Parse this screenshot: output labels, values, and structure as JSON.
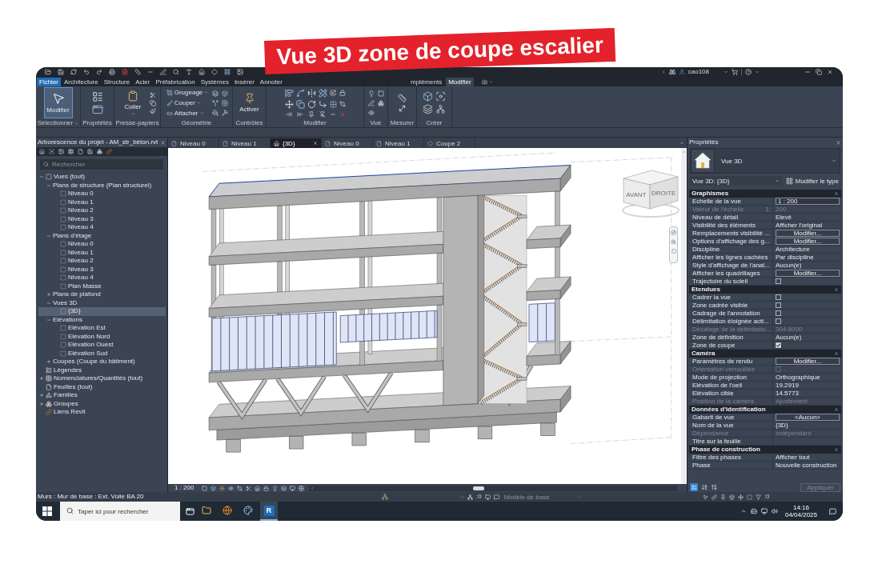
{
  "headline": {
    "text": "Vue 3D zone de coupe escalier"
  },
  "title_bar": {
    "user": "cao108"
  },
  "ribbon": {
    "tabs": [
      {
        "label": "Fichier",
        "kind": "file",
        "selected": false
      },
      {
        "label": "Architecture",
        "kind": "tab",
        "selected": false
      },
      {
        "label": "Structure",
        "kind": "tab",
        "selected": false
      },
      {
        "label": "Acier",
        "kind": "tab",
        "selected": false
      },
      {
        "label": "Préfabrication",
        "kind": "tab",
        "selected": false
      },
      {
        "label": "Systèmes",
        "kind": "tab",
        "selected": false
      },
      {
        "label": "Insérer",
        "kind": "tab",
        "selected": false
      },
      {
        "label": "Annoter",
        "kind": "tab",
        "selected": false
      },
      {
        "label": "mpléments",
        "kind": "tab",
        "selected": false
      },
      {
        "label": "Modifier",
        "kind": "tab",
        "selected": true
      }
    ],
    "groups": [
      {
        "kind": "select",
        "label": "Sélectionner",
        "dropdown": true,
        "tools": [
          {
            "label": "Modifier",
            "selected": true,
            "dropdown": false
          }
        ]
      },
      {
        "kind": "properties",
        "label": "Propriétés",
        "dropdown": false
      },
      {
        "kind": "clipboard",
        "label": "Presse-papiers",
        "dropdown": false,
        "tools": [
          {
            "label": "Coller",
            "selected": false,
            "dropdown": true
          }
        ]
      },
      {
        "kind": "geometry",
        "label": "Géométrie",
        "dropdown": false,
        "tools": [
          {
            "label": "Grugeage",
            "selected": false,
            "dropdown": true
          },
          {
            "label": "Couper",
            "selected": false,
            "dropdown": true
          },
          {
            "label": "Attacher",
            "selected": false,
            "dropdown": true
          }
        ]
      },
      {
        "kind": "controls",
        "label": "Contrôles",
        "dropdown": false,
        "tools": [
          {
            "label": "Activer",
            "selected": false,
            "dropdown": false
          }
        ]
      },
      {
        "kind": "modify",
        "label": "Modifier",
        "dropdown": false
      },
      {
        "kind": "view",
        "label": "Vue",
        "dropdown": false
      },
      {
        "kind": "measure",
        "label": "Mesurer",
        "dropdown": false
      },
      {
        "kind": "create",
        "label": "Créer",
        "dropdown": false
      }
    ]
  },
  "project_browser": {
    "title": "Arborescence du projet - AM_str_béton.rvt",
    "search": {
      "placeholder": "Rechercher"
    },
    "tree": [
      {
        "label": "Vues (tout)",
        "kind": "views",
        "expanded": true,
        "selected": false,
        "children": [
          {
            "label": "Plans de structure (Plan structurel)",
            "kind": "category",
            "expanded": true,
            "selected": false,
            "children": [
              {
                "label": "Niveau 0",
                "kind": "view",
                "selected": false
              },
              {
                "label": "Niveau 1",
                "kind": "view",
                "selected": false
              },
              {
                "label": "Niveau 2",
                "kind": "view",
                "selected": false
              },
              {
                "label": "Niveau 3",
                "kind": "view",
                "selected": false
              },
              {
                "label": "Niveau 4",
                "kind": "view",
                "selected": false
              }
            ]
          },
          {
            "label": "Plans d'étage",
            "kind": "category",
            "expanded": true,
            "selected": false,
            "children": [
              {
                "label": "Niveau 0",
                "kind": "view",
                "selected": false
              },
              {
                "label": "Niveau 1",
                "kind": "view",
                "selected": false
              },
              {
                "label": "Niveau 2",
                "kind": "view",
                "selected": false
              },
              {
                "label": "Niveau 3",
                "kind": "view",
                "selected": false
              },
              {
                "label": "Niveau 4",
                "kind": "view",
                "selected": false
              },
              {
                "label": "Plan Masse",
                "kind": "view",
                "selected": false
              }
            ]
          },
          {
            "label": "Plans de plafond",
            "kind": "category",
            "expanded": false,
            "selected": false
          },
          {
            "label": "Vues 3D",
            "kind": "category",
            "expanded": true,
            "selected": false,
            "children": [
              {
                "label": "{3D}",
                "kind": "view",
                "selected": true
              }
            ]
          },
          {
            "label": "Elévations",
            "kind": "category",
            "expanded": true,
            "selected": false,
            "children": [
              {
                "label": "Elévation Est",
                "kind": "view",
                "selected": false
              },
              {
                "label": "Elévation Nord",
                "kind": "view",
                "selected": false
              },
              {
                "label": "Elévation Ouest",
                "kind": "view",
                "selected": false
              },
              {
                "label": "Elévation Sud",
                "kind": "view",
                "selected": false
              }
            ]
          },
          {
            "label": "Coupes (Coupe du bâtiment)",
            "kind": "category",
            "expanded": false,
            "selected": false
          }
        ]
      },
      {
        "label": "Légendes",
        "kind": "legends",
        "selected": false
      },
      {
        "label": "Nomenclatures/Quantités (tout)",
        "kind": "schedules",
        "expanded": false,
        "selected": false
      },
      {
        "label": "Feuilles (tout)",
        "kind": "sheets",
        "selected": false
      },
      {
        "label": "Familles",
        "kind": "families",
        "expanded": false,
        "selected": false
      },
      {
        "label": "Groupes",
        "kind": "groups",
        "expanded": false,
        "selected": false
      },
      {
        "label": "Liens Revit",
        "kind": "links",
        "selected": false
      }
    ]
  },
  "view_tabs": [
    {
      "label": "Niveau 0",
      "kind": "plan",
      "selected": false
    },
    {
      "label": "Niveau 1",
      "kind": "plan",
      "selected": false
    },
    {
      "label": "{3D}",
      "kind": "model",
      "selected": true
    },
    {
      "label": "Niveau 0",
      "kind": "plan",
      "selected": false
    },
    {
      "label": "Niveau 1",
      "kind": "plan",
      "selected": false
    },
    {
      "label": "Coupe 2",
      "kind": "section",
      "selected": false
    }
  ],
  "viewport": {
    "view_cube": {
      "front": "AVANT",
      "right": "DROITE"
    }
  },
  "view_control_bar": {
    "scale": "1 : 200"
  },
  "properties": {
    "title": "Propriétés",
    "type": "Vue 3D",
    "instance": "Vue 3D: {3D}",
    "edit_type": "Modifier le type",
    "sections": [
      {
        "title": "Graphismes",
        "expanded": true,
        "rows": [
          {
            "kind": "input",
            "label": "Echelle de la vue",
            "value": "1 : 200",
            "disabled": false
          },
          {
            "kind": "text",
            "label": "Valeur de l'échelle",
            "unit": "1:",
            "value": "200",
            "disabled": true
          },
          {
            "kind": "text",
            "label": "Niveau de détail",
            "value": "Elevé",
            "disabled": false
          },
          {
            "kind": "text",
            "label": "Visibilité des éléments",
            "value": "Afficher l'original",
            "disabled": false
          },
          {
            "kind": "button",
            "label": "Remplacements visibilité ...",
            "value": "Modifier...",
            "disabled": false
          },
          {
            "kind": "button",
            "label": "Options d'affichage des g...",
            "value": "Modifier...",
            "disabled": false
          },
          {
            "kind": "text",
            "label": "Discipline",
            "value": "Architecture",
            "disabled": false
          },
          {
            "kind": "text",
            "label": "Afficher les lignes cachées",
            "value": "Par discipline",
            "disabled": false
          },
          {
            "kind": "text",
            "label": "Style d'affichage de l'anal...",
            "value": "Aucun(e)",
            "disabled": false
          },
          {
            "kind": "button",
            "label": "Afficher les quadrillages",
            "value": "Modifier...",
            "disabled": false
          },
          {
            "kind": "checkbox",
            "label": "Trajectoire du soleil",
            "checked": false,
            "disabled": false
          }
        ]
      },
      {
        "title": "Etendues",
        "expanded": true,
        "rows": [
          {
            "kind": "checkbox",
            "label": "Cadrer la vue",
            "checked": false,
            "disabled": false
          },
          {
            "kind": "checkbox",
            "label": "Zone cadrée visible",
            "checked": false,
            "disabled": false
          },
          {
            "kind": "checkbox",
            "label": "Cadrage de l'annotation",
            "checked": false,
            "disabled": false
          },
          {
            "kind": "checkbox",
            "label": "Délimitation éloignée acti...",
            "checked": false,
            "disabled": false
          },
          {
            "kind": "text",
            "label": "Décalage de la délimitatio...",
            "value": "304.8000",
            "disabled": true
          },
          {
            "kind": "text",
            "label": "Zone de définition",
            "value": "Aucun(e)",
            "disabled": false
          },
          {
            "kind": "checkbox",
            "label": "Zone de coupe",
            "checked": true,
            "disabled": false
          }
        ]
      },
      {
        "title": "Caméra",
        "expanded": true,
        "rows": [
          {
            "kind": "button",
            "label": "Paramètres de rendu",
            "value": "Modifier...",
            "disabled": false
          },
          {
            "kind": "checkbox",
            "label": "Orientation verrouillée",
            "checked": false,
            "disabled": true
          },
          {
            "kind": "text",
            "label": "Mode de projection",
            "value": "Orthographique",
            "disabled": false
          },
          {
            "kind": "text",
            "label": "Elévation de l'oeil",
            "value": "19.2919",
            "disabled": false
          },
          {
            "kind": "text",
            "label": "Elévation cible",
            "value": "14.5773",
            "disabled": false
          },
          {
            "kind": "text",
            "label": "Position de la caméra",
            "value": "Ajustement",
            "disabled": true
          }
        ]
      },
      {
        "title": "Données d'identification",
        "expanded": true,
        "rows": [
          {
            "kind": "button",
            "label": "Gabarit de vue",
            "value": "<Aucun>",
            "disabled": false
          },
          {
            "kind": "text",
            "label": "Nom de la vue",
            "value": "{3D}",
            "disabled": false
          },
          {
            "kind": "text",
            "label": "Dépendance",
            "value": "Indépendant",
            "disabled": true
          },
          {
            "kind": "text",
            "label": "Titre sur la feuille",
            "disabled": false
          }
        ]
      },
      {
        "title": "Phase de construction",
        "expanded": true,
        "rows": [
          {
            "kind": "text",
            "label": "Filtre des phases",
            "value": "Afficher tout",
            "disabled": false
          },
          {
            "kind": "text",
            "label": "Phase",
            "value": "Nouvelle construction",
            "disabled": false
          }
        ]
      }
    ],
    "apply": {
      "label": "Appliquer",
      "disabled": true
    }
  },
  "status_bar": {
    "message": "Murs : Mur de base : Ext. Voile BA 20",
    "counter": ":0",
    "design_option": "Modèle de base",
    "filter_count": ":0"
  },
  "taskbar": {
    "search": {
      "placeholder": "Taper ici pour rechercher"
    },
    "apps": [
      {
        "kind": "explorer",
        "selected": false
      },
      {
        "kind": "browser",
        "selected": false
      },
      {
        "kind": "paint",
        "selected": false
      },
      {
        "kind": "revit",
        "label": "R",
        "selected": true
      }
    ],
    "time": "14:16",
    "date": "04/04/2025"
  }
}
